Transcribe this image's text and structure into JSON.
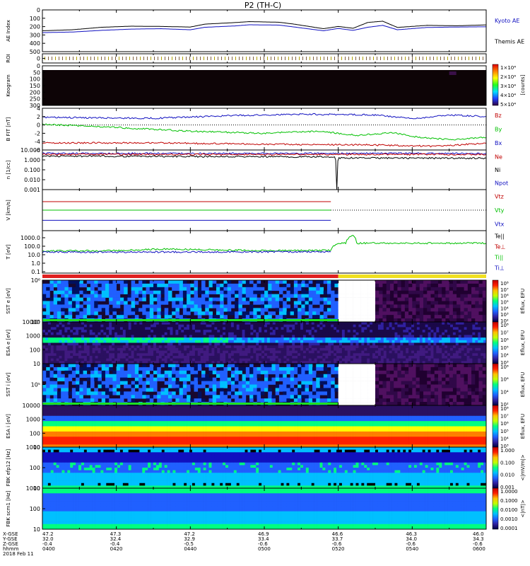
{
  "chart_data": {
    "type": "line",
    "title": "P2 (TH-C)",
    "date_label": "2018 Feb 11",
    "time_axis": {
      "row_labels": [
        "X-GSE",
        "Y-GSE",
        "Z-GSE",
        "hhmm"
      ],
      "ticks": [
        {
          "time": "0400",
          "x": "47.2",
          "y": "32.0",
          "z": "-0.4"
        },
        {
          "time": "0420",
          "x": "47.3",
          "y": "32.4",
          "z": "-0.4"
        },
        {
          "time": "0440",
          "x": "47.2",
          "y": "32.9",
          "z": "-0.5"
        },
        {
          "time": "0500",
          "x": "46.9",
          "y": "33.4",
          "z": "-0.6"
        },
        {
          "time": "0520",
          "x": "46.6",
          "y": "33.7",
          "z": "-0.6"
        },
        {
          "time": "0540",
          "x": "46.3",
          "y": "34.0",
          "z": "-0.6"
        },
        {
          "time": "0600",
          "x": "46.0",
          "y": "34.3",
          "z": "-0.6"
        }
      ]
    },
    "panels": [
      {
        "id": "ae",
        "ylabel": "AE Index",
        "ylim": [
          0,
          500
        ],
        "ticks": [
          "0",
          "100",
          "200",
          "300",
          "400",
          "500"
        ],
        "legend": [
          {
            "name": "Kyoto AE",
            "color": "#1010c0"
          },
          {
            "name": "Themis AE",
            "color": "#000000"
          }
        ],
        "series": [
          {
            "name": "Kyoto AE",
            "color": "#1010c0",
            "points": [
              [
                0,
                228
              ],
              [
                8,
                235
              ],
              [
                16,
                255
              ],
              [
                24,
                270
              ],
              [
                32,
                275
              ],
              [
                40,
                262
              ],
              [
                44,
                292
              ],
              [
                52,
                308
              ],
              [
                56,
                322
              ],
              [
                64,
                318
              ],
              [
                68,
                296
              ],
              [
                76,
                250
              ],
              [
                80,
                278
              ],
              [
                84,
                255
              ],
              [
                88,
                292
              ],
              [
                92,
                315
              ],
              [
                96,
                262
              ],
              [
                104,
                290
              ],
              [
                112,
                295
              ],
              [
                120,
                298
              ]
            ]
          },
          {
            "name": "Themis AE",
            "color": "#000000",
            "points": [
              [
                0,
                250
              ],
              [
                8,
                262
              ],
              [
                16,
                292
              ],
              [
                24,
                305
              ],
              [
                32,
                302
              ],
              [
                40,
                295
              ],
              [
                44,
                330
              ],
              [
                52,
                348
              ],
              [
                56,
                360
              ],
              [
                64,
                352
              ],
              [
                68,
                330
              ],
              [
                76,
                275
              ],
              [
                80,
                302
              ],
              [
                84,
                280
              ],
              [
                88,
                350
              ],
              [
                92,
                365
              ],
              [
                96,
                290
              ],
              [
                104,
                315
              ],
              [
                112,
                310
              ],
              [
                120,
                320
              ]
            ]
          }
        ]
      },
      {
        "id": "roi",
        "ylabel": "ROI",
        "ticks": [
          "0"
        ]
      },
      {
        "id": "keogram",
        "ylabel": "Keogram",
        "ylim": [
          0,
          300
        ],
        "ticks": [
          "0",
          "50",
          "100",
          "150",
          "200",
          "250",
          "300"
        ],
        "colorbar": {
          "label": "[counts]",
          "ticks": [
            "1×10⁴",
            "2×10⁴",
            "3×10⁴",
            "4×10⁴",
            "5×10⁴"
          ]
        }
      },
      {
        "id": "bfield",
        "ylabel": "B FIT [nT]",
        "ylim": [
          -6,
          4
        ],
        "ticks": [
          "4",
          "2",
          "0",
          "-2",
          "-4",
          "-6"
        ],
        "legend": [
          {
            "name": "Bz",
            "color": "#c00000"
          },
          {
            "name": "By",
            "color": "#00c000"
          },
          {
            "name": "Bx",
            "color": "#1010c0"
          }
        ],
        "series": [
          {
            "name": "Bx",
            "color": "#1010c0",
            "points": [
              [
                0,
                1.8
              ],
              [
                30,
                1.6
              ],
              [
                50,
                2.2
              ],
              [
                70,
                2.6
              ],
              [
                90,
                2.4
              ],
              [
                100,
                1.5
              ],
              [
                110,
                2.4
              ],
              [
                120,
                2.0
              ]
            ]
          },
          {
            "name": "By",
            "color": "#00c000",
            "points": [
              [
                0,
                0.2
              ],
              [
                20,
                -0.6
              ],
              [
                40,
                -1.5
              ],
              [
                60,
                -2.0
              ],
              [
                75,
                -1.5
              ],
              [
                85,
                -2.5
              ],
              [
                95,
                -1.8
              ],
              [
                100,
                -2.8
              ],
              [
                110,
                -3.5
              ],
              [
                120,
                -3.0
              ]
            ]
          },
          {
            "name": "Bz",
            "color": "#c00000",
            "points": [
              [
                0,
                -4.3
              ],
              [
                30,
                -4.3
              ],
              [
                60,
                -4.6
              ],
              [
                90,
                -4.8
              ],
              [
                105,
                -5.1
              ],
              [
                120,
                -4.4
              ]
            ]
          }
        ]
      },
      {
        "id": "density",
        "ylabel": "n [1/cc]",
        "ylim": [
          0.001,
          10
        ],
        "ticks": [
          "10.000",
          "1.000",
          "0.100",
          "0.010",
          "0.001"
        ],
        "legend": [
          {
            "name": "Ne",
            "color": "#c00000"
          },
          {
            "name": "Ni",
            "color": "#000000"
          },
          {
            "name": "Npot",
            "color": "#1010c0"
          }
        ],
        "series": [
          {
            "name": "Npot",
            "color": "#1010c0",
            "points": [
              [
                0,
                4.5
              ],
              [
                120,
                4.5
              ]
            ]
          },
          {
            "name": "Ne",
            "color": "#c00000",
            "points": [
              [
                0,
                3.6
              ],
              [
                60,
                3.5
              ],
              [
                120,
                3.6
              ]
            ]
          },
          {
            "name": "Ni",
            "color": "#000000",
            "points": [
              [
                0,
                2.4
              ],
              [
                50,
                2.2
              ],
              [
                79,
                2.0
              ],
              [
                79.6,
                0.0011
              ],
              [
                80.2,
                1.6
              ],
              [
                100,
                1.5
              ],
              [
                120,
                1.5
              ]
            ]
          }
        ]
      },
      {
        "id": "velocity",
        "ylabel": "V [km/s]",
        "legend": [
          {
            "name": "Vtz",
            "color": "#c00000"
          },
          {
            "name": "Vty",
            "color": "#00c000"
          },
          {
            "name": "Vtx",
            "color": "#1010c0"
          }
        ],
        "series": [
          {
            "name": "Vtz",
            "color": "#c00000",
            "points": [
              [
                0,
                1
              ],
              [
                78,
                1
              ]
            ]
          },
          {
            "name": "Vty",
            "color": "#00c000",
            "points": [
              [
                0,
                0
              ],
              [
                78,
                0
              ]
            ]
          },
          {
            "name": "Vtx",
            "color": "#1010c0",
            "points": [
              [
                0,
                -1.2
              ],
              [
                78,
                -1.2
              ]
            ]
          }
        ]
      },
      {
        "id": "temperature",
        "ylabel": "T [eV]",
        "ylim": [
          0.1,
          5000
        ],
        "ticks": [
          "1000.0",
          "100.0",
          "10.0",
          "1.0",
          "0.1"
        ],
        "legend": [
          {
            "name": "Te||",
            "color": "#000000"
          },
          {
            "name": "Te⊥",
            "color": "#c00000"
          },
          {
            "name": "Ti||",
            "color": "#00c000"
          },
          {
            "name": "Ti⊥",
            "color": "#1010c0"
          }
        ],
        "series": [
          {
            "name": "Ti||",
            "color": "#00c000",
            "points": [
              [
                0,
                28
              ],
              [
                20,
                30
              ],
              [
                34,
                48
              ],
              [
                45,
                38
              ],
              [
                60,
                30
              ],
              [
                78,
                32
              ],
              [
                80,
                220
              ],
              [
                82,
                230
              ],
              [
                84,
                2000
              ],
              [
                85,
                230
              ],
              [
                120,
                230
              ]
            ]
          },
          {
            "name": "Te⊥",
            "color": "#1010c0",
            "points": [
              [
                0,
                20
              ],
              [
                78,
                22
              ]
            ]
          }
        ]
      },
      {
        "id": "mode_bar",
        "segments": [
          {
            "from": 0,
            "to": 80,
            "color": "#e02020"
          },
          {
            "from": 80,
            "to": 120,
            "color": "#f0e020"
          }
        ]
      },
      {
        "id": "sst_e",
        "ylabel": "SST e [eV]",
        "ticks": [
          "10⁶",
          "10⁵"
        ],
        "colorbar": {
          "label": "Eflux, EFU",
          "ticks": [
            "10⁸",
            "10⁷",
            "10⁶",
            "10⁵",
            "10⁴",
            "10³",
            "10²"
          ]
        }
      },
      {
        "id": "esa_e",
        "ylabel": "ESA e [eV]",
        "ylim": [
          10,
          10000
        ],
        "ticks": [
          "10000",
          "1000",
          "100",
          "10"
        ],
        "colorbar": {
          "label": "Eflux, EFU",
          "ticks": [
            "10⁸",
            "10⁷",
            "10⁶",
            "10⁵",
            "10⁴",
            "10³"
          ]
        }
      },
      {
        "id": "sst_i",
        "ylabel": "SST i [eV]",
        "ticks": [
          "10⁵"
        ],
        "colorbar": {
          "label": "Eflux, EFU",
          "ticks": [
            "10⁸",
            "10⁶",
            "10⁴",
            "10²"
          ]
        }
      },
      {
        "id": "esa_i",
        "ylabel": "ESA i [eV]",
        "ylim": [
          10,
          10000
        ],
        "ticks": [
          "10000",
          "1000",
          "100",
          "10"
        ],
        "colorbar": {
          "label": "Eflux, EFU",
          "ticks": [
            "10⁸",
            "10⁷",
            "10⁶",
            "10⁵",
            "10⁴",
            "10³"
          ]
        }
      },
      {
        "id": "fbk_e",
        "ylabel": "FBK efp12 [Hz]",
        "ylim": [
          1,
          1000
        ],
        "ticks": [
          "1000",
          "100",
          "10"
        ],
        "colorbar": {
          "label": "<|mV/m|>",
          "ticks": [
            "1.000",
            "0.100",
            "0.010",
            "0.001"
          ]
        }
      },
      {
        "id": "fbk_b",
        "ylabel": "FBK scm1 [Hz]",
        "ylim": [
          1,
          1000
        ],
        "ticks": [
          "1000",
          "100",
          "10"
        ],
        "colorbar": {
          "label": "<|nT|>",
          "ticks": [
            "1.0000",
            "0.1000",
            "0.0100",
            "0.0010",
            "0.0001"
          ]
        }
      }
    ]
  }
}
